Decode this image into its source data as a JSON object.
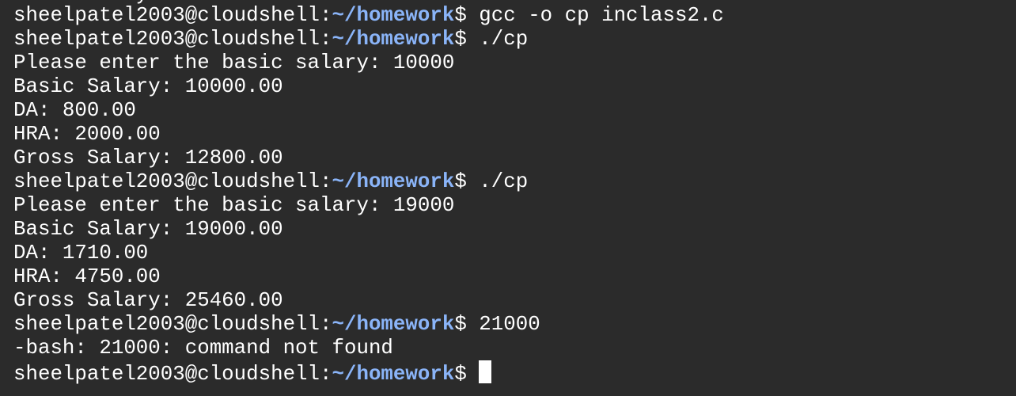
{
  "terminal": {
    "peek_text": "          y",
    "prompt_user": "sheelpatel2003@cloudshell:",
    "prompt_path": "~/homework",
    "prompt_symbol": "$ ",
    "lines": [
      {
        "type": "prompt",
        "command": "gcc -o cp inclass2.c"
      },
      {
        "type": "prompt",
        "command": "./cp"
      },
      {
        "type": "output",
        "text": "Please enter the basic salary: 10000"
      },
      {
        "type": "output",
        "text": "Basic Salary: 10000.00"
      },
      {
        "type": "output",
        "text": "DA: 800.00"
      },
      {
        "type": "output",
        "text": "HRA: 2000.00"
      },
      {
        "type": "output",
        "text": "Gross Salary: 12800.00"
      },
      {
        "type": "prompt",
        "command": "./cp"
      },
      {
        "type": "output",
        "text": "Please enter the basic salary: 19000"
      },
      {
        "type": "output",
        "text": "Basic Salary: 19000.00"
      },
      {
        "type": "output",
        "text": "DA: 1710.00"
      },
      {
        "type": "output",
        "text": "HRA: 4750.00"
      },
      {
        "type": "output",
        "text": "Gross Salary: 25460.00"
      },
      {
        "type": "prompt",
        "command": "21000"
      },
      {
        "type": "output",
        "text": "-bash: 21000: command not found"
      },
      {
        "type": "prompt",
        "command": "",
        "cursor": true
      }
    ]
  }
}
